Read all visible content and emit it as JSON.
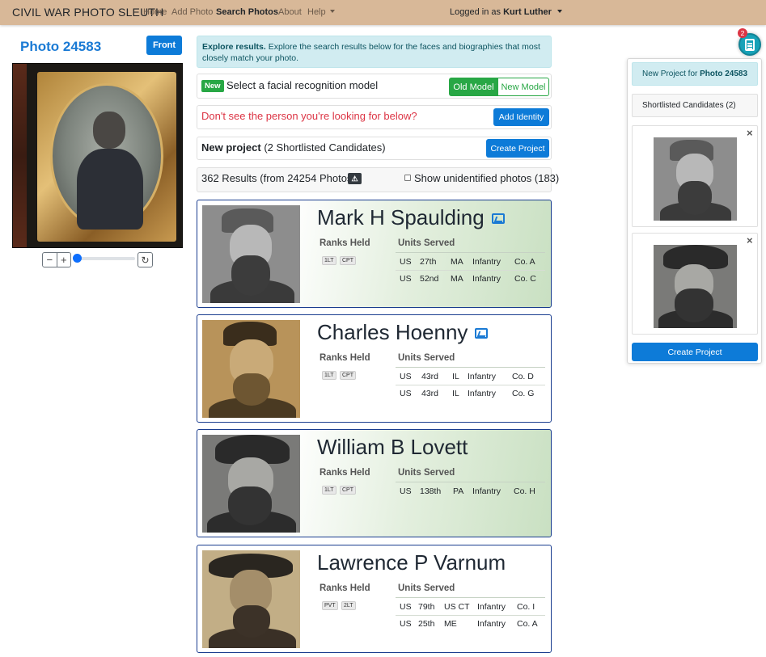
{
  "navbar": {
    "brand": "CIVIL WAR PHOTO SLEUTH",
    "links": [
      "Home",
      "Add Photo",
      "Search Photos",
      "About",
      "Help"
    ],
    "user_prefix": "Logged in as",
    "user_name": "Kurt Luther"
  },
  "left": {
    "photo_title": "Photo 24583",
    "front_button": "Front",
    "zoom_out": "−",
    "zoom_in": "+",
    "reset": "↻",
    "zoom_level": 0
  },
  "explore": {
    "title": "Explore results.",
    "text": "Explore the search results below for the faces and biographies that most closely match your photo."
  },
  "model": {
    "badge": "New",
    "label": "Select a facial recognition model",
    "old_button": "Old Model",
    "new_button": "New Model"
  },
  "identity": {
    "prompt": "Don't see the person you're looking for below?",
    "button": "Add Identity"
  },
  "project": {
    "bold": "New project",
    "rest": "(2 Shortlisted Candidates)",
    "button": "Create Project"
  },
  "results": {
    "summary": "362 Results (from 24254 Photos)",
    "warning_icon": "⚠",
    "checkbox_label": "Show unidentified photos (183)"
  },
  "cards": [
    {
      "name": "Mark H Spaulding",
      "ranks_header": "Ranks Held",
      "units_header": "Units Served",
      "ranks": [
        "1LT",
        "CPT"
      ],
      "units": [
        [
          "US",
          "27th",
          "MA",
          "Infantry",
          "Co. A"
        ],
        [
          "US",
          "52nd",
          "MA",
          "Infantry",
          "Co. C"
        ]
      ]
    },
    {
      "name": "Charles Hoenny",
      "ranks_header": "Ranks Held",
      "units_header": "Units Served",
      "ranks": [
        "1LT",
        "CPT"
      ],
      "units": [
        [
          "US",
          "43rd",
          "IL",
          "Infantry",
          "Co. D"
        ],
        [
          "US",
          "43rd",
          "IL",
          "Infantry",
          "Co. G"
        ]
      ]
    },
    {
      "name": "William B Lovett",
      "ranks_header": "Ranks Held",
      "units_header": "Units Served",
      "ranks": [
        "1LT",
        "CPT"
      ],
      "units": [
        [
          "US",
          "138th",
          "PA",
          "Infantry",
          "Co. H"
        ]
      ]
    },
    {
      "name": "Lawrence P Varnum",
      "ranks_header": "Ranks Held",
      "units_header": "Units Served",
      "ranks": [
        "PVT",
        "2LT"
      ],
      "units": [
        [
          "US",
          "79th",
          "US CT",
          "Infantry",
          "Co. I"
        ],
        [
          "US",
          "25th",
          "ME",
          "Infantry",
          "Co. A"
        ]
      ]
    }
  ],
  "panel": {
    "count": "2",
    "header_prefix": "New Project for",
    "header_photo": "Photo 24583",
    "shortlisted": "Shortlisted Candidates (2)",
    "close": "×",
    "create_button": "Create Project"
  },
  "colors": {
    "navbar": "#d8b898",
    "primary": "#0d7bd8",
    "success": "#28a745",
    "danger": "#dc3545",
    "info_bg": "#d1ecf1",
    "card_border": "#1a3d8f"
  }
}
